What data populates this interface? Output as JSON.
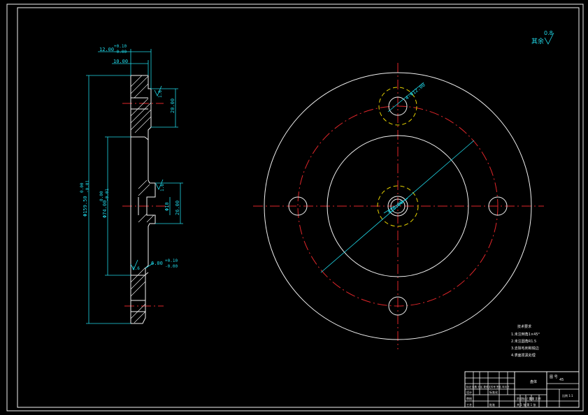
{
  "roughness_note": {
    "label": "其余",
    "value": "0.8"
  },
  "side_view_dims": {
    "d_top_width": "12.00",
    "d_top_tol_upper": "+0.10",
    "d_top_tol_lower": "-0.00",
    "d_10": "10.00",
    "d_20": "20.00",
    "d_outer_dia": "Φ159.50",
    "d_outer_tol_upper": "0.00",
    "d_outer_tol_lower": "-0.01",
    "d_inner_dia": "Φ74.00",
    "d_inner_tol_upper": "0.00",
    "d_inner_tol_lower": "-0.01",
    "d_26": "26.00",
    "d_bore": "Φ10",
    "d_6": "6.00",
    "d_6_tol_upper": "+0.10",
    "d_6_tol_lower": "-0.00",
    "rough_1": "1.6",
    "rough_2": "1.6",
    "rough_3": "1.6"
  },
  "front_view_dims": {
    "hole_callout": "4-Φ12.00",
    "center_dia": "Φ20.00"
  },
  "tech_notes": {
    "title": "技术要求",
    "lines": [
      "1.未注倒角1×45°",
      "2.未注圆角R1.5",
      "3.去除毛刺和锐边",
      "4.表面发黑处理"
    ]
  },
  "title_block": {
    "cell_a": "图 号",
    "cell_b": "盘体",
    "cell_c": "45",
    "cell_d": "比例 1:1",
    "cell_e": "共 1 张 第 1 张",
    "cell_f": "标记 处数 分区 更改文件号 签名 年月日",
    "cell_g": "设计",
    "cell_h": "审核",
    "cell_i": "工艺",
    "cell_j": "批准",
    "cell_k": "标准化",
    "cell_l": "阶段标记 重量 比例"
  }
}
